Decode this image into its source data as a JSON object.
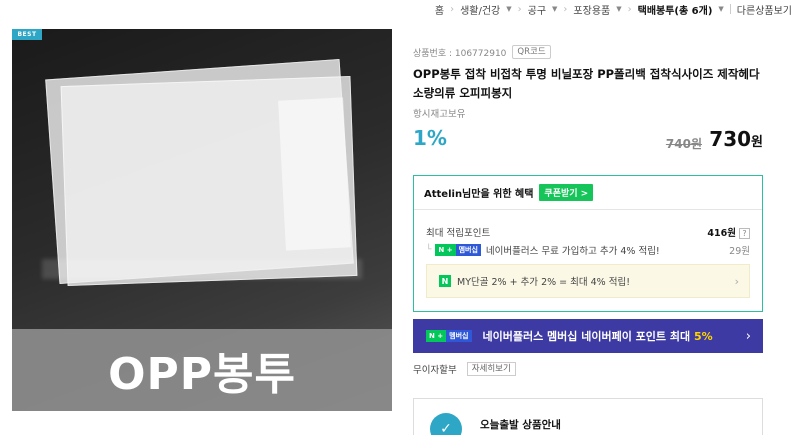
{
  "breadcrumb": {
    "items": [
      {
        "label": "홈",
        "has_menu": false
      },
      {
        "label": "생활/건강",
        "has_menu": true
      },
      {
        "label": "공구",
        "has_menu": true
      },
      {
        "label": "포장용품",
        "has_menu": true
      },
      {
        "label": "택배봉투(총 6개)",
        "has_menu": true,
        "strong": true
      }
    ],
    "other_label": "다른상품보기"
  },
  "image": {
    "best_badge": "BEST",
    "banner_text": "OPP봉투"
  },
  "product": {
    "code_label": "상품번호 : 106772910",
    "qr_label": "QR코드",
    "title": "OPP봉투 접착 비접착 투명 비닐포장 PP폴리백 접착식사이즈 제작헤다 소량의류 오피피봉지",
    "stock_label": "항시재고보유",
    "discount": "1%",
    "original_price": "740원",
    "price": "730",
    "price_unit": "원"
  },
  "benefit": {
    "head_label": "Attelin님만을 위한 혜택",
    "coupon_label": "쿠폰받기 >",
    "max_points_label": "최대 적립포인트",
    "max_points_value": "416원",
    "help": "?",
    "naverplus_badge_n": "N +",
    "naverplus_badge_m": "멤버십",
    "naverplus_text": "네이버플러스 무료 가입하고 추가 4% 적립!",
    "naverplus_amount": "29원",
    "my_icon": "N",
    "my_text": "MY단골 2% + 추가 2% = 최대 4% 적립!",
    "accent_color": "#2cc0a0"
  },
  "np_banner": {
    "badge_n": "N +",
    "badge_m": "멤버십",
    "text_main": "네이버플러스 멤버십 네이버페이 포인트 최대 ",
    "text_highlight": "5%",
    "bg_color": "#3d3aa3"
  },
  "installment": {
    "label": "무이자할부",
    "detail_label": "자세히보기"
  },
  "shipping": {
    "icon": "truck-icon",
    "label": "오늘출발 상품안내"
  }
}
